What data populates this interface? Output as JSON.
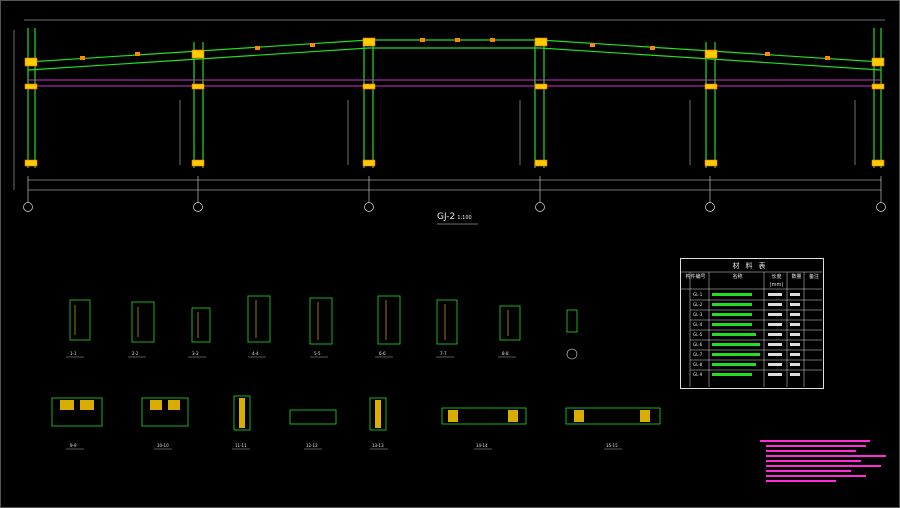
{
  "frame": {
    "title": "GJ-2",
    "scale": "1:100"
  },
  "material_table": {
    "title": "材料表",
    "headers": [
      "构件编号",
      "名称",
      "长度(mm)",
      "数量",
      "备注"
    ],
    "rows": [
      {
        "id": "GL-1"
      },
      {
        "id": "GL-2"
      },
      {
        "id": "GL-3"
      },
      {
        "id": "GL-4"
      },
      {
        "id": "GL-5"
      },
      {
        "id": "GL-6"
      },
      {
        "id": "GL-7"
      },
      {
        "id": "GL-8"
      },
      {
        "id": "GL-9"
      }
    ]
  },
  "sections_row1": [
    "1-1",
    "2-2",
    "3-3",
    "4-4",
    "5-5",
    "6-6",
    "7-7",
    "8-8"
  ],
  "sections_row2": [
    "9-9",
    "10-10",
    "11-11",
    "12-12",
    "13-13",
    "14-14",
    "15-15"
  ],
  "colors": {
    "structure": "#22dd22",
    "bracing": "#cc33cc",
    "dimension": "#e6e6e6",
    "node": "#ffcc00",
    "note": "#ff2bd6"
  }
}
